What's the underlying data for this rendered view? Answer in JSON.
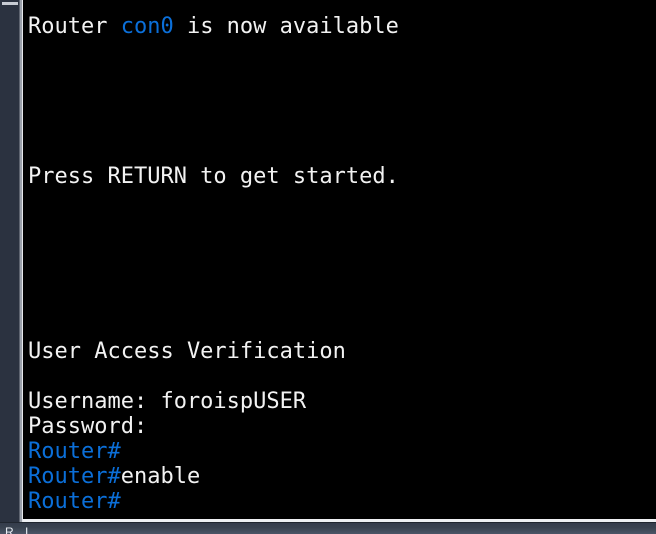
{
  "colors": {
    "terminal_background": "#000000",
    "terminal_text": "#f2f2f2",
    "prompt_blue": "#0b6fd9",
    "sidebar": "#2b3240",
    "divider": "#9aa0aa",
    "taskbar": "#3a4250"
  },
  "terminal": {
    "lines": [
      {
        "row": 0,
        "segments": [
          {
            "text": "Router ",
            "color": "white"
          },
          {
            "text": "con0",
            "color": "blue"
          },
          {
            "text": " is now available",
            "color": "white"
          }
        ]
      },
      {
        "row": 6,
        "segments": [
          {
            "text": "Press RETURN to get started.",
            "color": "white"
          }
        ]
      },
      {
        "row": 13,
        "segments": [
          {
            "text": "User Access Verification",
            "color": "white"
          }
        ]
      },
      {
        "row": 15,
        "segments": [
          {
            "text": "Username: foroispUSER",
            "color": "white"
          }
        ]
      },
      {
        "row": 16,
        "segments": [
          {
            "text": "Password:",
            "color": "white"
          }
        ]
      },
      {
        "row": 17,
        "segments": [
          {
            "text": "Router#",
            "color": "blue"
          }
        ]
      },
      {
        "row": 18,
        "segments": [
          {
            "text": "Router#",
            "color": "blue"
          },
          {
            "text": "enable",
            "color": "white"
          }
        ]
      },
      {
        "row": 19,
        "segments": [
          {
            "text": "Router#",
            "color": "blue"
          }
        ]
      }
    ],
    "line_1": "Router con0 is now available",
    "line_2": "Press RETURN to get started.",
    "line_3": "User Access Verification",
    "line_4": "Username: foroispUSER",
    "line_5": "Password:",
    "line_6": "Router#",
    "line_7": "Router#enable",
    "line_8": "Router#",
    "username_value": "foroispUSER",
    "command_entered": "enable",
    "prompt_symbol": "Router#"
  },
  "taskbar": {
    "items": [
      {
        "label": "R"
      },
      {
        "label": "I"
      }
    ]
  }
}
